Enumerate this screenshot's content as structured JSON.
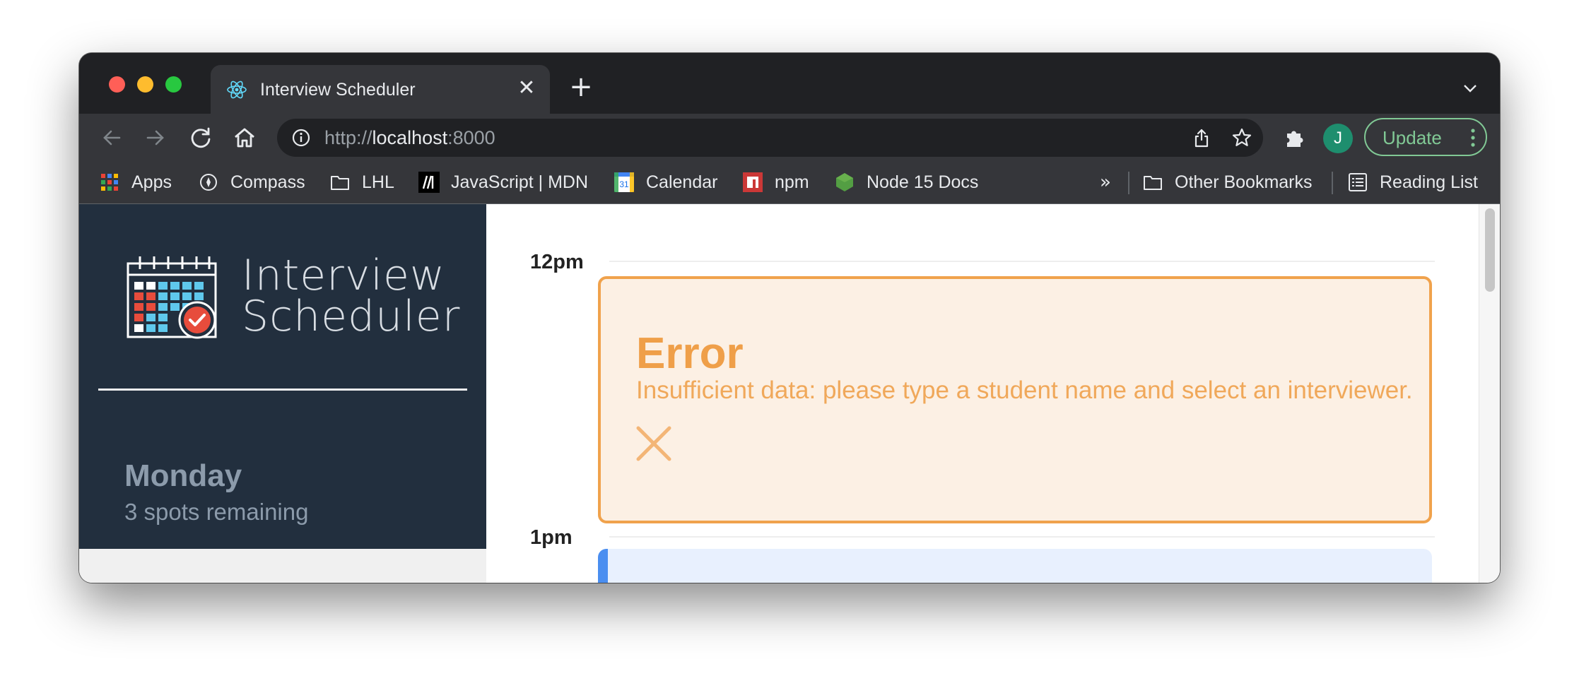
{
  "browser": {
    "tab": {
      "title": "Interview Scheduler",
      "favicon": "react-icon"
    },
    "new_tab_symbol": "+",
    "close_symbol": "✕",
    "address": {
      "scheme": "http://",
      "host": "localhost",
      "port": ":8000"
    },
    "profile_initial": "J",
    "update_label": "Update",
    "bookmarks": [
      {
        "label": "Apps",
        "icon": "apps-grid-icon"
      },
      {
        "label": "Compass",
        "icon": "compass-icon"
      },
      {
        "label": "LHL",
        "icon": "folder-icon"
      },
      {
        "label": "JavaScript | MDN",
        "icon": "mdn-icon"
      },
      {
        "label": "Calendar",
        "icon": "google-calendar-icon"
      },
      {
        "label": "npm",
        "icon": "npm-icon"
      },
      {
        "label": "Node 15 Docs",
        "icon": "nodejs-icon"
      }
    ],
    "bookmarks_overflow": "»",
    "other_bookmarks": "Other Bookmarks",
    "reading_list": "Reading List"
  },
  "app": {
    "logo_line1": "Interview",
    "logo_line2": "Scheduler",
    "day": {
      "name": "Monday",
      "spots": "3 spots remaining"
    },
    "schedule": {
      "slots": [
        "12pm",
        "1pm"
      ],
      "error": {
        "title": "Error",
        "message": "Insufficient data: please type a student name and select an interviewer."
      }
    }
  },
  "colors": {
    "sidebar_dark": "#222f3e",
    "error_border": "#f0a24c",
    "error_bg": "#fcf0e4",
    "update_green": "#81c995",
    "appointment_blue": "#4a8ef0"
  }
}
